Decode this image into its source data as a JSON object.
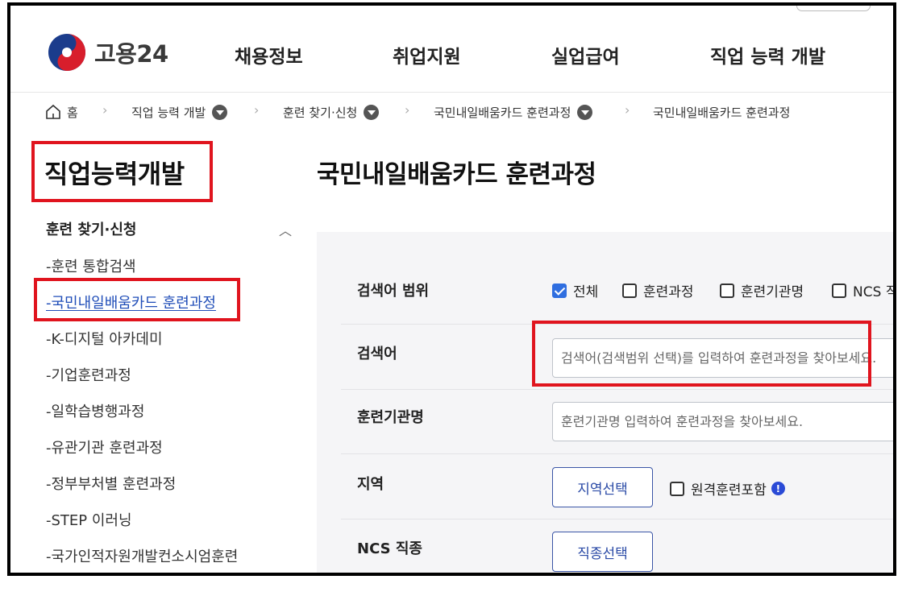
{
  "brand": {
    "name": "고용24"
  },
  "nav": {
    "items": [
      "채용정보",
      "취업지원",
      "실업급여",
      "직업 능력 개발"
    ]
  },
  "breadcrumb": {
    "home": "홈",
    "items": [
      "직업 능력 개발",
      "훈련 찾기·신청",
      "국민내일배움카드 훈련과정",
      "국민내일배움카드 훈련과정"
    ]
  },
  "sidebar": {
    "title": "직업능력개발",
    "category": "훈련 찾기·신청",
    "items": [
      "-훈련 통합검색",
      "-국민내일배움카드 훈련과정",
      "-K-디지털 아카데미",
      "-기업훈련과정",
      "-일학습병행과정",
      "-유관기관 훈련과정",
      "-정부부처별 훈련과정",
      "-STEP 이러닝",
      "-국가인적자원개발컨소시엄훈련"
    ]
  },
  "main": {
    "title": "국민내일배움카드 훈련과정",
    "scope": {
      "label": "검색어 범위",
      "options": [
        {
          "label": "전체",
          "checked": true
        },
        {
          "label": "훈련과정",
          "checked": false
        },
        {
          "label": "훈련기관명",
          "checked": false
        },
        {
          "label": "NCS 직",
          "checked": false
        }
      ]
    },
    "keyword": {
      "label": "검색어",
      "placeholder": "검색어(검색범위 선택)를 입력하여 훈련과정을 찾아보세요."
    },
    "institution": {
      "label": "훈련기관명",
      "placeholder": "훈련기관명 입력하여 훈련과정을 찾아보세요."
    },
    "region": {
      "label": "지역",
      "button": "지역선택",
      "remote_label": "원격훈련포함",
      "info_glyph": "!"
    },
    "ncs": {
      "label": "NCS 직종",
      "button": "직종선택"
    }
  },
  "colors": {
    "highlight_border": "#e0141e",
    "checkbox_checked": "#2f6ee0",
    "link_active": "#1f4db8"
  }
}
